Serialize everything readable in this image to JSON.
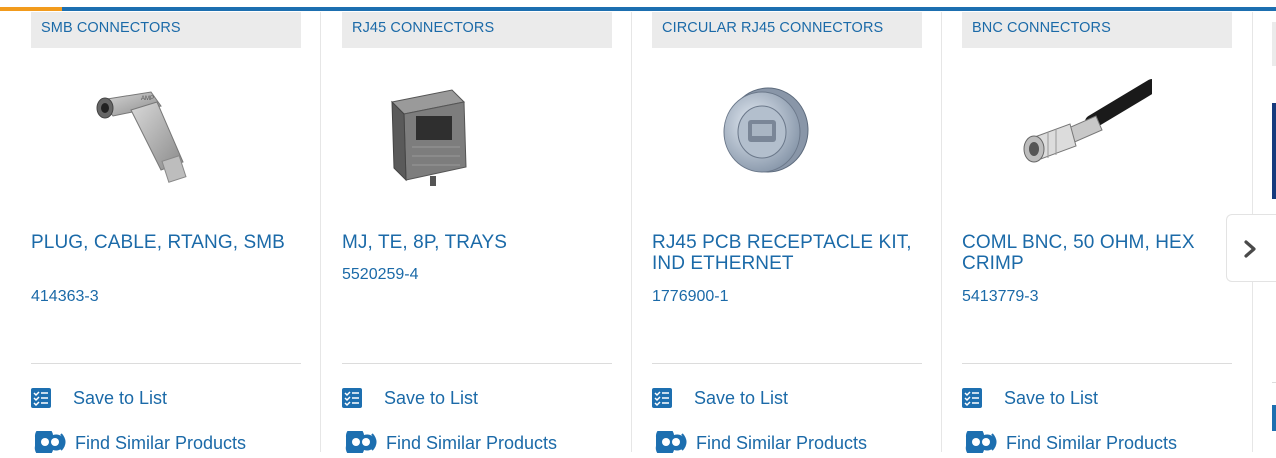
{
  "products": [
    {
      "category": "SMB CONNECTORS",
      "title": "PLUG, CABLE, RTANG, SMB",
      "part_number": "414363-3",
      "save_label": "Save to List",
      "find_label": "Find Similar Products"
    },
    {
      "category": "RJ45 CONNECTORS",
      "title": "MJ, TE, 8P, TRAYS",
      "part_number": "5520259-4",
      "save_label": "Save to List",
      "find_label": "Find Similar Products"
    },
    {
      "category": "CIRCULAR RJ45 CONNECTORS",
      "title": "RJ45 PCB RECEPTACLE KIT, IND ETHERNET",
      "part_number": "1776900-1",
      "save_label": "Save to List",
      "find_label": "Find Similar Products"
    },
    {
      "category": "BNC CONNECTORS",
      "title": "COML BNC, 50 OHM, HEX CRIMP",
      "part_number": "5413779-3",
      "save_label": "Save to List",
      "find_label": "Find Similar Products"
    }
  ],
  "carousel": {
    "next_icon": "chevron-right-icon"
  },
  "colors": {
    "link": "#1b6aa8",
    "accent_orange": "#f29b1d",
    "accent_blue": "#1d6fb0",
    "category_bg": "#ebebeb"
  }
}
